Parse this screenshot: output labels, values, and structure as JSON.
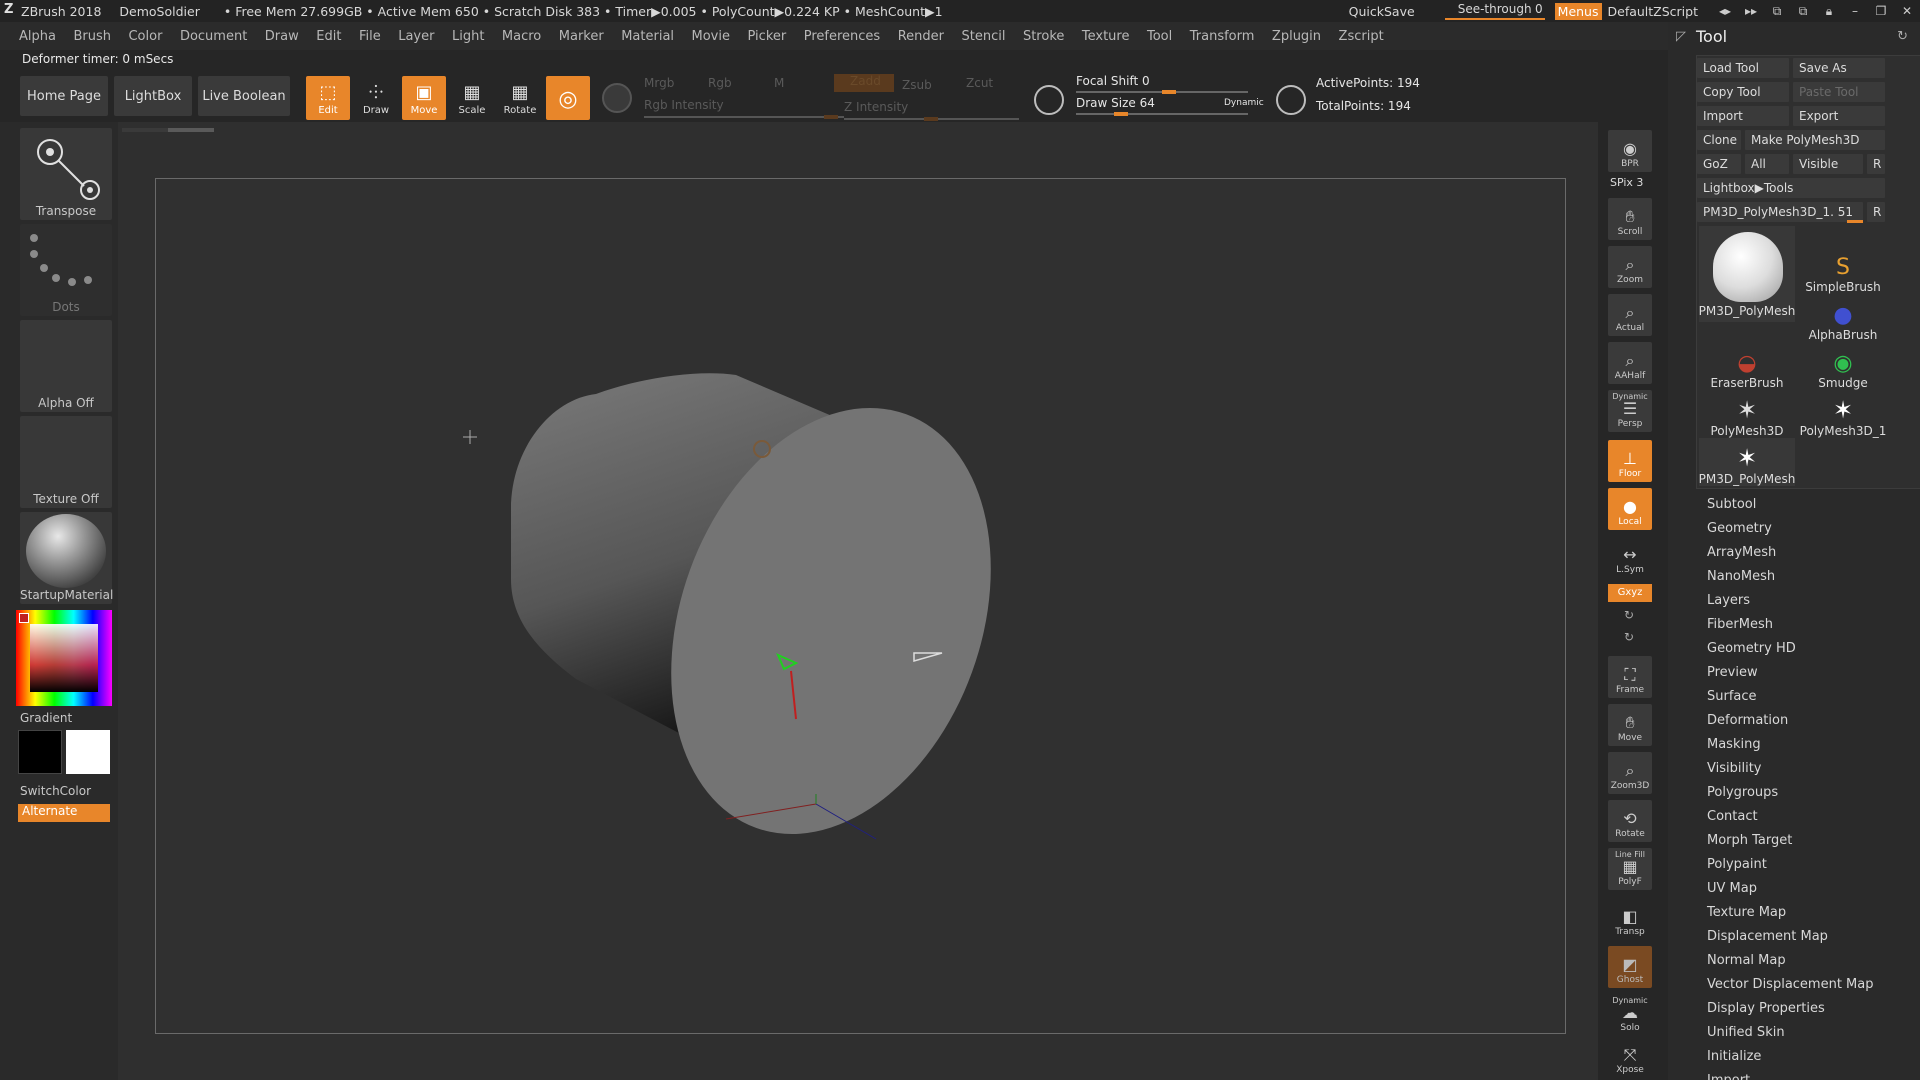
{
  "titlebar": {
    "app": "ZBrush 2018",
    "project": "DemoSoldier",
    "stats": "• Free Mem 27.699GB • Active Mem 650 • Scratch Disk 383 • Timer▶0.005 • PolyCount▶0.224 KP • MeshCount▶1",
    "quicksave": "QuickSave",
    "seethrough_label": "See-through",
    "seethrough_value": "0",
    "menus": "Menus",
    "default_script": "DefaultZScript"
  },
  "menubar": [
    "Alpha",
    "Brush",
    "Color",
    "Document",
    "Draw",
    "Edit",
    "File",
    "Layer",
    "Light",
    "Macro",
    "Marker",
    "Material",
    "Movie",
    "Picker",
    "Preferences",
    "Render",
    "Stencil",
    "Stroke",
    "Texture",
    "Tool",
    "Transform",
    "Zplugin",
    "Zscript"
  ],
  "status": {
    "deformer": "Deformer timer: 0 mSecs"
  },
  "shelf": {
    "home": "Home Page",
    "lightbox": "LightBox",
    "live_boolean": "Live Boolean",
    "edit": "Edit",
    "draw": "Draw",
    "move": "Move",
    "scale": "Scale",
    "rotate": "Rotate",
    "mrgb": "Mrgb",
    "rgb": "Rgb",
    "m": "M",
    "zadd": "Zadd",
    "zsub": "Zsub",
    "zcut": "Zcut",
    "rgb_intensity": "Rgb Intensity",
    "z_intensity": "Z Intensity",
    "focal_shift_label": "Focal Shift",
    "focal_shift_value": "0",
    "draw_size_label": "Draw Size",
    "draw_size_value": "64",
    "dynamic": "Dynamic",
    "active_points": "ActivePoints: 194",
    "total_points": "TotalPoints: 194"
  },
  "left_palette": {
    "transpose": "Transpose",
    "dots": "Dots",
    "alpha": "Alpha Off",
    "texture": "Texture Off",
    "material": "StartupMaterial",
    "gradient": "Gradient",
    "switchcolor": "SwitchColor",
    "alternate": "Alternate"
  },
  "right_shelf": {
    "bpr": "BPR",
    "spix": "SPix 3",
    "scroll": "Scroll",
    "zoom": "Zoom",
    "actual": "Actual",
    "aahalf": "AAHalf",
    "dynamic": "Dynamic",
    "persp": "Persp",
    "floor": "Floor",
    "local": "Local",
    "lsym": "L.Sym",
    "xyz": "Gxyz",
    "frame": "Frame",
    "move": "Move",
    "zoom3d": "Zoom3D",
    "rotate": "Rotate",
    "linefill": "Line Fill",
    "polyf": "PolyF",
    "transp": "Transp",
    "ghost": "Ghost",
    "dynamic2": "Dynamic",
    "solo": "Solo",
    "xpose": "Xpose"
  },
  "tool_panel": {
    "title": "Tool",
    "load_tool": "Load Tool",
    "save_as": "Save As",
    "copy_tool": "Copy Tool",
    "paste_tool": "Paste Tool",
    "import": "Import",
    "export": "Export",
    "clone": "Clone",
    "make_polymesh": "Make PolyMesh3D",
    "goz": "GoZ",
    "all": "All",
    "visible": "Visible",
    "r": "R",
    "lightbox_tools": "Lightbox▶Tools",
    "current_tool": "PM3D_PolyMesh3D_1. 51",
    "thumbs": [
      "PM3D_PolyMesh",
      "SimpleBrush",
      "AlphaBrush",
      "EraserBrush",
      "Smudge",
      "PolyMesh3D",
      "PolyMesh3D_1",
      "PM3D_PolyMesh"
    ],
    "sections": [
      "Subtool",
      "Geometry",
      "ArrayMesh",
      "NanoMesh",
      "Layers",
      "FiberMesh",
      "Geometry HD",
      "Preview",
      "Surface",
      "Deformation",
      "Masking",
      "Visibility",
      "Polygroups",
      "Contact",
      "Morph Target",
      "Polypaint",
      "UV Map",
      "Texture Map",
      "Displacement Map",
      "Normal Map",
      "Vector Displacement Map",
      "Display Properties",
      "Unified Skin",
      "Initialize",
      "Import"
    ]
  },
  "colors": {
    "accent": "#e8862a",
    "panel": "#2a2a2a",
    "button": "#3a3a3a",
    "canvas": "#303030"
  }
}
